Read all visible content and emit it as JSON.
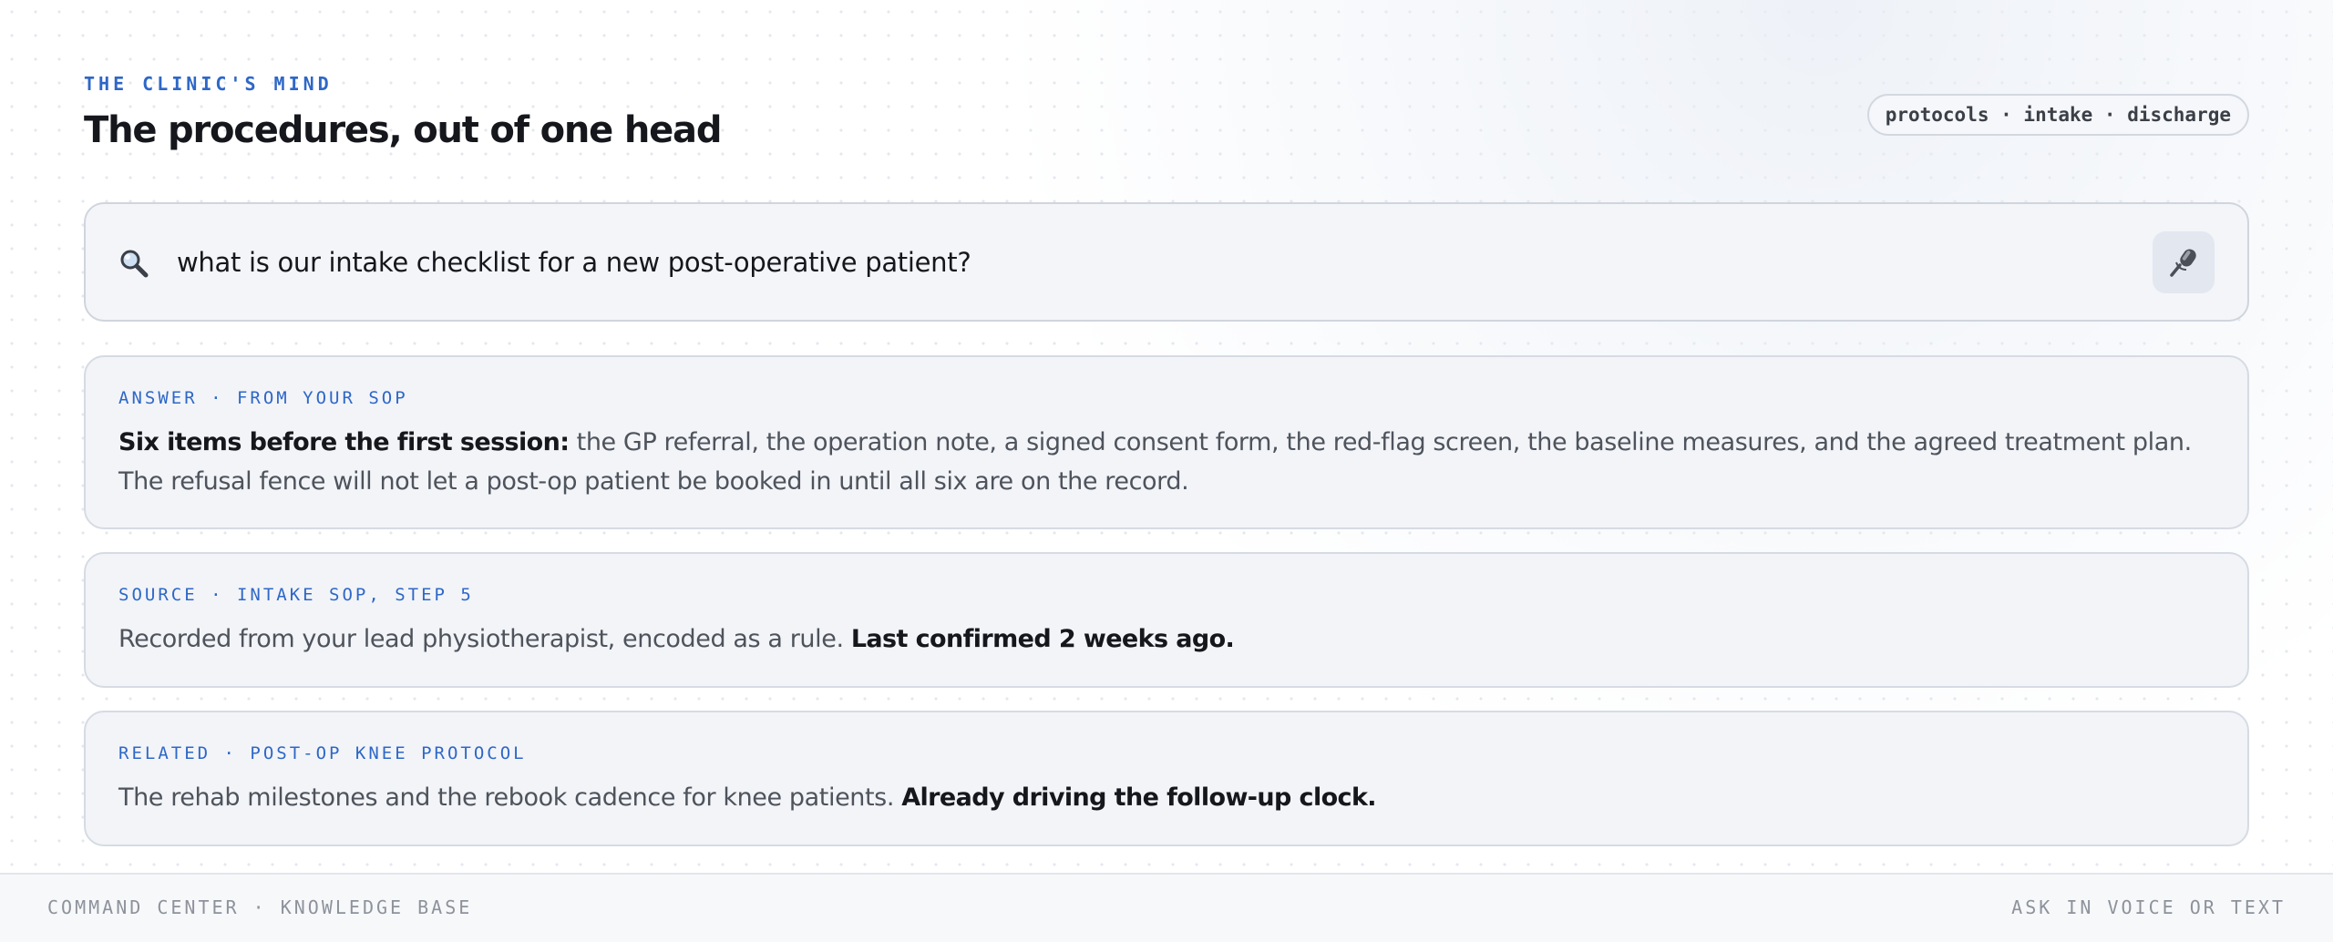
{
  "header": {
    "eyebrow": "THE CLINIC'S MIND",
    "title": "The procedures, out of one head",
    "tags": "protocols · intake · discharge"
  },
  "search": {
    "query": "what is our intake checklist for a new post-operative patient?",
    "icon": "search-icon",
    "mic_icon": "microphone-icon"
  },
  "cards": {
    "answer": {
      "label": "ANSWER · FROM YOUR SOP",
      "lead": "Six items before the first session:",
      "text": " the GP referral, the operation note, a signed consent form, the red-flag screen, the baseline measures, and the agreed treatment plan. The refusal fence will not let a post-op patient be booked in until all six are on the record."
    },
    "source": {
      "label": "SOURCE · INTAKE SOP, STEP 5",
      "text": "Recorded from your lead physiotherapist, encoded as a rule. ",
      "emphasis": "Last confirmed 2 weeks ago."
    },
    "related": {
      "label": "RELATED · POST-OP KNEE PROTOCOL",
      "text": "The rehab milestones and the rebook cadence for knee patients. ",
      "emphasis": "Already driving the follow-up clock."
    }
  },
  "footer": {
    "left": "COMMAND CENTER · KNOWLEDGE BASE",
    "right": "ASK IN VOICE OR TEXT"
  },
  "colors": {
    "accent": "#2e67c7",
    "card_background": "#f2f4f8",
    "card_border": "#d6dbe3",
    "text_strong": "#15171c",
    "text_muted": "#4e535c"
  }
}
